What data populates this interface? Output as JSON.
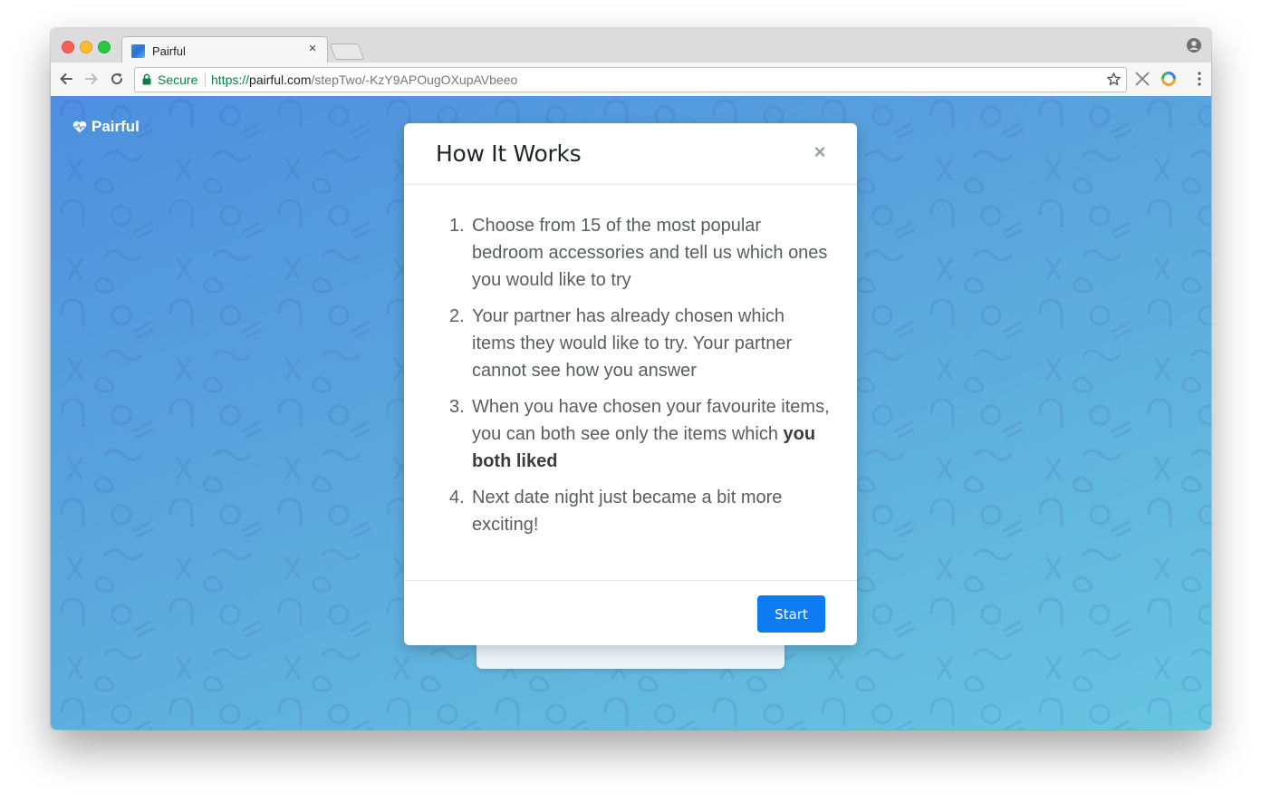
{
  "browser": {
    "tab": {
      "title": "Pairful"
    },
    "address": {
      "secure_label": "Secure",
      "scheme": "https://",
      "host": "pairful.com",
      "path": "/stepTwo/-KzY9APOugOXupAVbeeo"
    },
    "icons": [
      "back-icon",
      "forward-icon",
      "reload-icon",
      "lock-icon",
      "star-icon",
      "extension-x-icon",
      "extension-ring-icon",
      "menu-icon",
      "profile-icon"
    ]
  },
  "page": {
    "brand": "Pairful",
    "background_colors": [
      "#4d8fdf",
      "#67c6e0"
    ]
  },
  "modal": {
    "title": "How It Works",
    "close_symbol": "×",
    "steps": [
      {
        "num": "1.",
        "text": "Choose from 15 of the most popular bedroom accessories and tell us which ones you would like to try",
        "bold": ""
      },
      {
        "num": "2.",
        "text": "Your partner has already chosen which items they would like to try. Your partner cannot see how you answer",
        "bold": ""
      },
      {
        "num": "3.",
        "text": "When you have chosen your favourite items, you can both see only the items which ",
        "bold": "you both liked"
      },
      {
        "num": "4.",
        "text": "Next date night just became a bit more exciting!",
        "bold": ""
      }
    ],
    "primary_button": "Start",
    "primary_color": "#0d7cf2"
  }
}
